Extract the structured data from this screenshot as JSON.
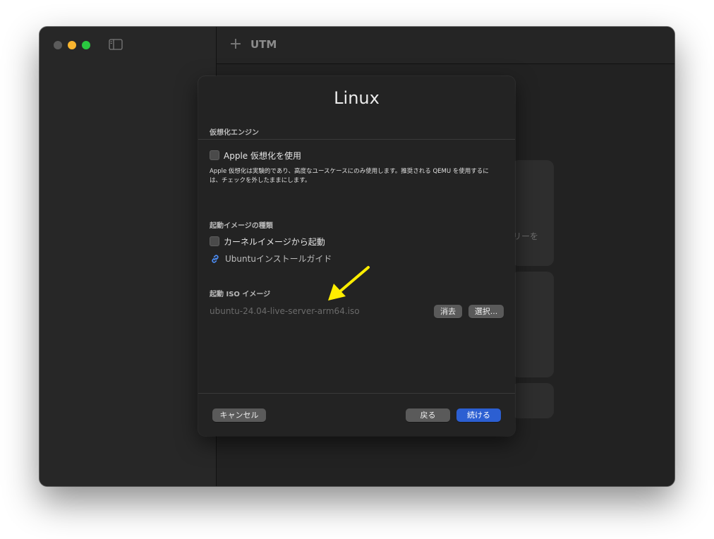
{
  "app": {
    "title": "UTM"
  },
  "background": {
    "partial_text": "リーを"
  },
  "dialog": {
    "title": "Linux",
    "engine_section": {
      "label": "仮想化エンジン",
      "apple_virt_checkbox": {
        "label": "Apple 仮想化を使用",
        "checked": false
      },
      "description": "Apple 仮想化は実験的であり、高度なユースケースにのみ使用します。推奨される QEMU を使用するには、チェックを外したままにします。"
    },
    "boot_type_section": {
      "label": "起動イメージの種類",
      "kernel_checkbox": {
        "label": "カーネルイメージから起動",
        "checked": false
      },
      "guide_link": "Ubuntuインストールガイド"
    },
    "iso_section": {
      "label": "起動 ISO イメージ",
      "path": "ubuntu-24.04-live-server-arm64.iso",
      "clear_button": "消去",
      "choose_button": "選択..."
    },
    "footer": {
      "cancel_button": "キャンセル",
      "back_button": "戻る",
      "continue_button": "続ける"
    }
  },
  "colors": {
    "accent": "#2c5fd2",
    "annotation_arrow": "#ffee00"
  },
  "icons": {
    "link": "link-icon",
    "sidebar_toggle": "sidebar-toggle-icon",
    "add": "plus-icon",
    "annotation": "arrow-annotation"
  }
}
